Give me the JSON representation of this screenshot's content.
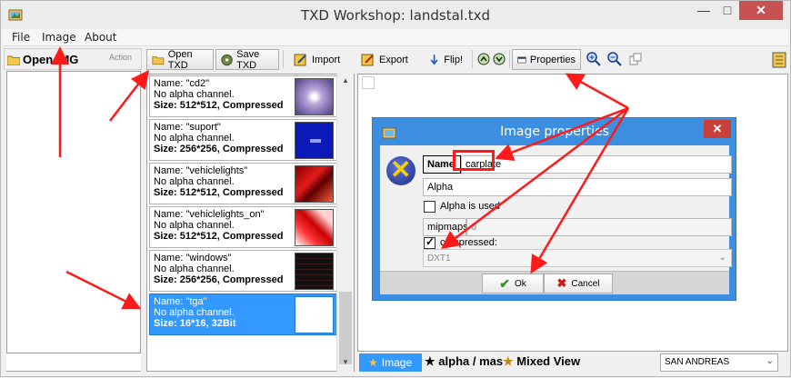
{
  "window": {
    "title": "TXD Workshop: landstal.txd",
    "min": "—",
    "max": "□",
    "close": "✕"
  },
  "menu": [
    "File",
    "Image",
    "About"
  ],
  "left_panel": {
    "open_label": "Open IMG",
    "action_label": "Action"
  },
  "toolbar": {
    "open_txd": "Open TXD",
    "save_txd": "Save TXD",
    "import": "Import",
    "export": "Export",
    "flip": "Flip!",
    "properties": "Properties"
  },
  "textures": [
    {
      "name": "Name: \"cd2\"",
      "alpha": "No alpha channel.",
      "size": "Size: 512*512, Compressed",
      "thumb": "cd"
    },
    {
      "name": "Name: \"suport\"",
      "alpha": "No alpha channel.",
      "size": "Size: 256*256, Compressed",
      "thumb": "blue"
    },
    {
      "name": "Name: \"vehiclelights\"",
      "alpha": "No alpha channel.",
      "size": "Size: 512*512, Compressed",
      "thumb": "red"
    },
    {
      "name": "Name: \"vehiclelights_on\"",
      "alpha": "No alpha channel.",
      "size": "Size: 512*512, Compressed",
      "thumb": "redlight"
    },
    {
      "name": "Name: \"windows\"",
      "alpha": "No alpha channel.",
      "size": "Size: 256*256, Compressed",
      "thumb": "dark"
    },
    {
      "name": "Name: \"tga\"",
      "alpha": "No alpha channel.",
      "size": "Size: 16*16, 32Bit",
      "thumb": "white",
      "selected": true
    }
  ],
  "view_tabs": {
    "image": "Image",
    "alpha": "alpha / mas",
    "mixed": "Mixed View"
  },
  "game_select": "SAN ANDREAS",
  "dialog": {
    "title": "Image properties",
    "name_label": "Name",
    "name_value": "carplate",
    "alpha_field": "Alpha",
    "alpha_used_label": "Alpha is used",
    "mipmaps_label": "mipmaps",
    "mipmaps_value": "0",
    "compressed_label": "compressed:",
    "compression": "DXT1",
    "ok": "Ok",
    "cancel": "Cancel"
  },
  "colors": {
    "selection": "#3399ff",
    "dialog_title": "#3c8ee0",
    "annotation": "#ff1a1a"
  }
}
